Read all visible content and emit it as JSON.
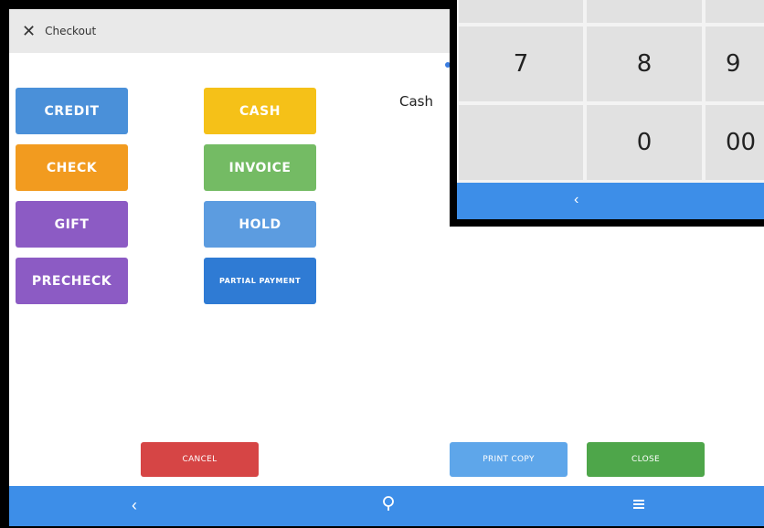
{
  "header": {
    "close_glyph": "✕",
    "title": "Checkout"
  },
  "payment_methods": {
    "credit": {
      "label": "CREDIT",
      "color": "#4a90d9"
    },
    "cash": {
      "label": "CASH",
      "color": "#f5c118"
    },
    "check": {
      "label": "CHECK",
      "color": "#f29b1f"
    },
    "invoice": {
      "label": "INVOICE",
      "color": "#74bb64"
    },
    "gift": {
      "label": "GIFT",
      "color": "#8c5bc4"
    },
    "hold": {
      "label": "HOLD",
      "color": "#5c9ce0"
    },
    "precheck": {
      "label": "PRECHECK",
      "color": "#8c5bc4"
    },
    "partial_payment": {
      "label": "PARTIAL PAYMENT",
      "color": "#2f7bd4"
    }
  },
  "selected_method": {
    "label": "Cash"
  },
  "actions": {
    "cancel": {
      "label": "CANCEL",
      "color": "#d64545"
    },
    "print_copy": {
      "label": "PRINT COPY",
      "color": "#5ea6ea"
    },
    "close": {
      "label": "CLOSE",
      "color": "#4ea64a"
    }
  },
  "navbar": {
    "back_icon": "back-icon",
    "home_icon": "home-icon",
    "menu_icon": "menu-icon"
  },
  "keypad": {
    "keys": {
      "seven": "7",
      "eight": "8",
      "nine": "9",
      "zero": "0",
      "double_zero": "00"
    },
    "back_icon": "back-icon"
  }
}
